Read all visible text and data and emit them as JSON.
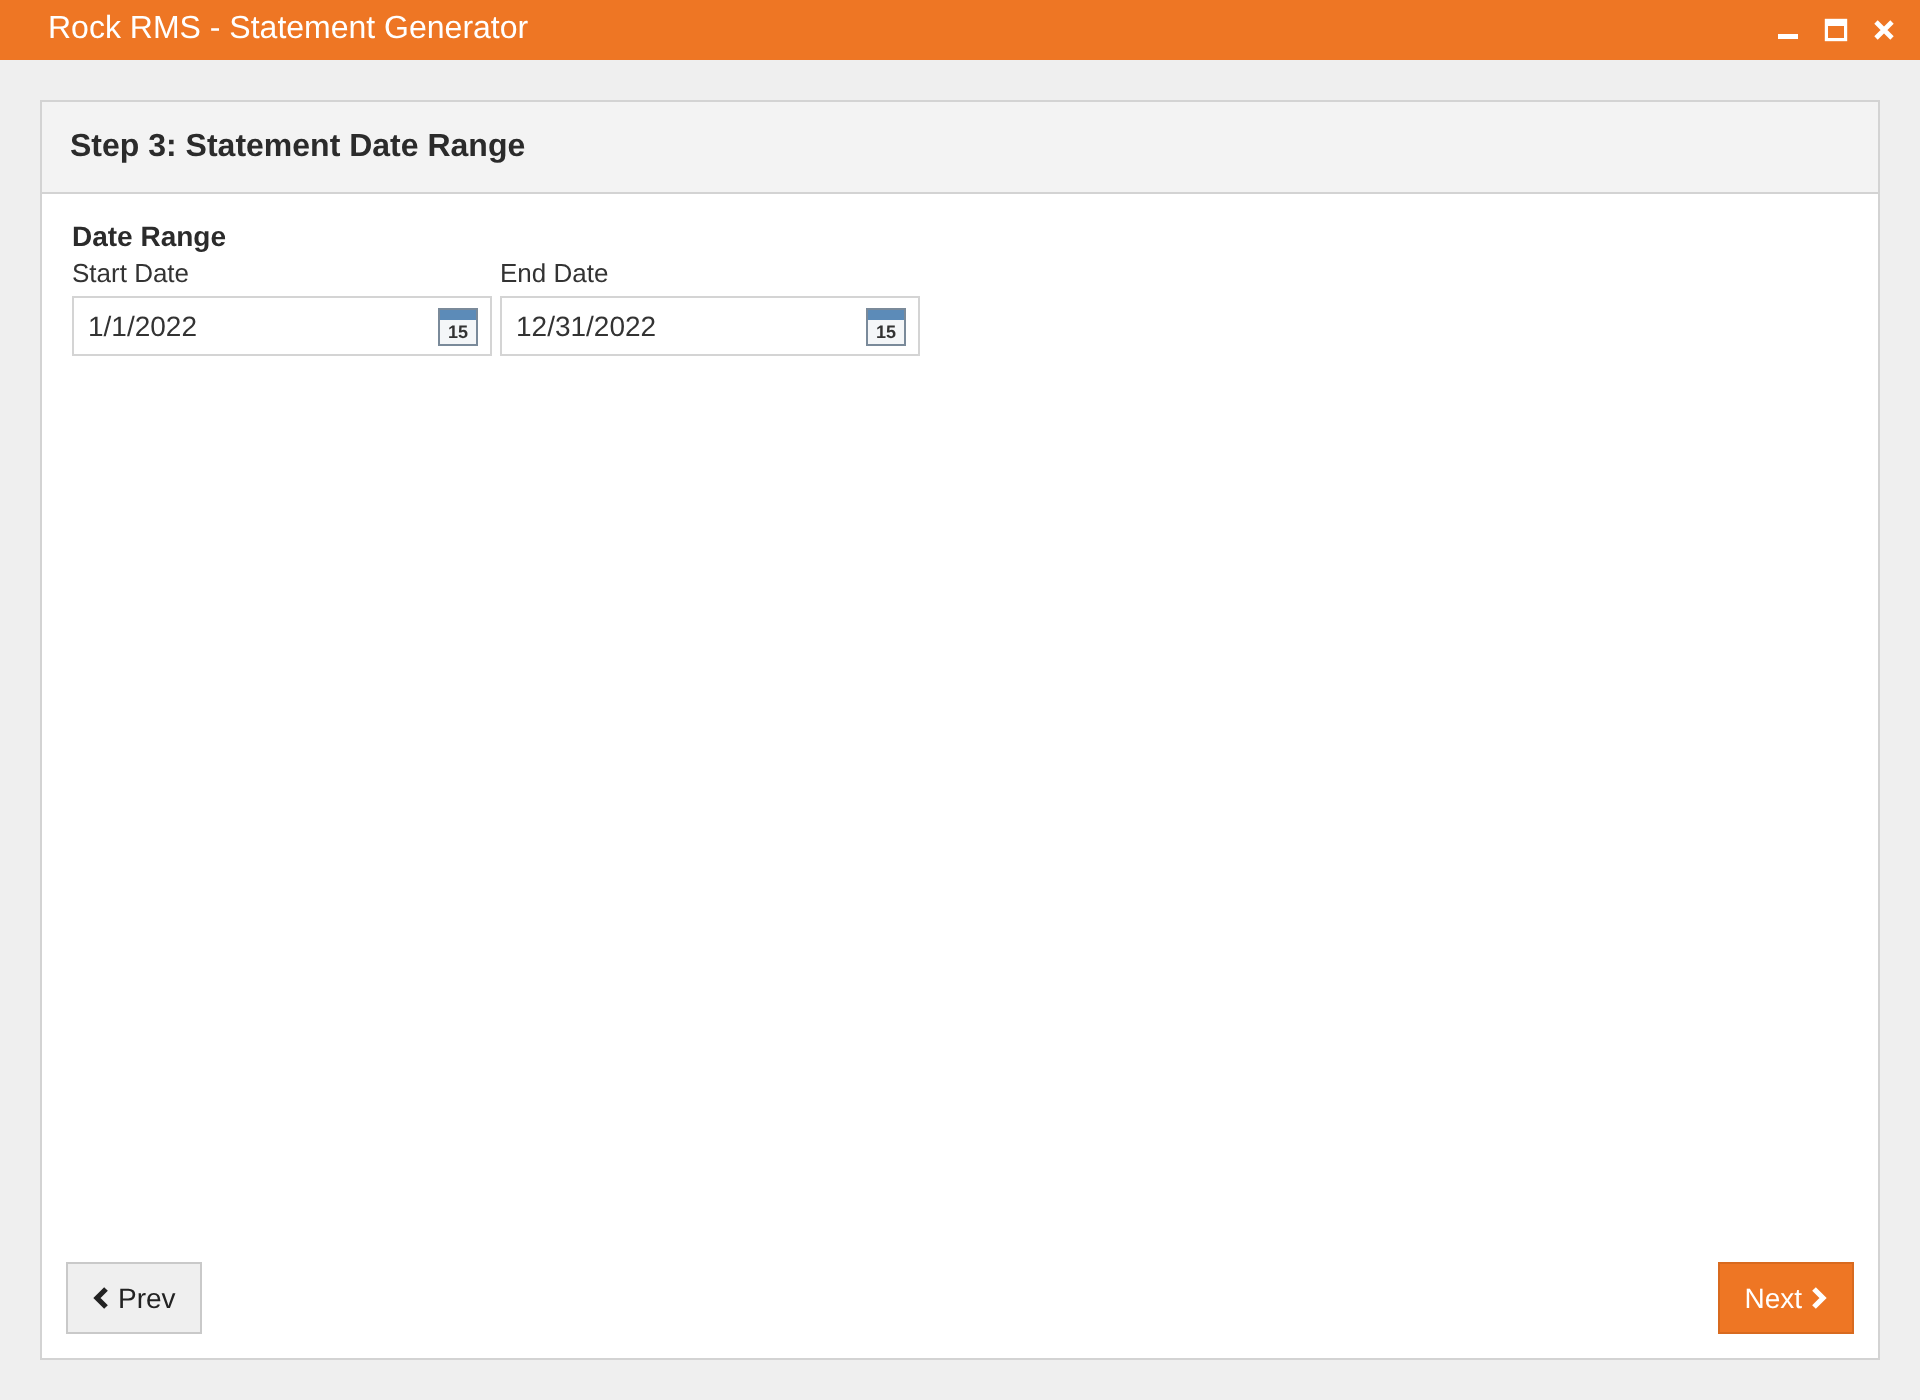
{
  "window": {
    "title": "Rock RMS - Statement Generator",
    "controls": [
      {
        "kind": "minimize"
      },
      {
        "kind": "maximize"
      },
      {
        "kind": "close"
      }
    ]
  },
  "panel": {
    "title": "Step 3: Statement Date Range",
    "section_title": "Date Range",
    "fields": [
      {
        "label": "Start Date",
        "value": "1/1/2022",
        "icon_text": "15"
      },
      {
        "label": "End Date",
        "value": "12/31/2022",
        "icon_text": "15"
      }
    ],
    "buttons": [
      {
        "kind": "prev",
        "label": "Prev"
      },
      {
        "kind": "next",
        "label": "Next"
      }
    ]
  }
}
